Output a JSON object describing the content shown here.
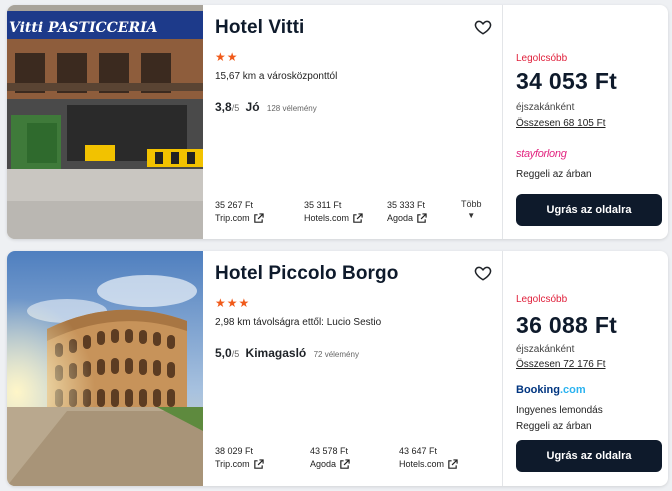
{
  "hotels": [
    {
      "name": "Hotel Vitti",
      "stars": "★★",
      "distance": "15,67 km a városközponttól",
      "score": "3,8",
      "of": "/5",
      "rating_word": "Jó",
      "reviews": "128 vélemény",
      "photo_sign": "Vitti PASTICCERIA",
      "offers": [
        {
          "price": "35 267 Ft",
          "site": "Trip.com"
        },
        {
          "price": "35 311 Ft",
          "site": "Hotels.com"
        },
        {
          "price": "35 333 Ft",
          "site": "Agoda"
        }
      ],
      "more_label": "Több",
      "cheapest_label": "Legolcsóbb",
      "best_price": "34 053 Ft",
      "per_night": "éjszakánként",
      "total": "Összesen 68 105 Ft",
      "provider": "stayforlong",
      "perks": [
        "Reggeli az árban"
      ],
      "cta": "Ugrás az oldalra"
    },
    {
      "name": "Hotel Piccolo Borgo",
      "stars": "★★★",
      "distance": "2,98 km távolságra ettől: Lucio Sestio",
      "score": "5,0",
      "of": "/5",
      "rating_word": "Kimagasló",
      "reviews": "72 vélemény",
      "offers": [
        {
          "price": "38 029 Ft",
          "site": "Trip.com"
        },
        {
          "price": "43 578 Ft",
          "site": "Agoda"
        },
        {
          "price": "43 647 Ft",
          "site": "Hotels.com"
        }
      ],
      "cheapest_label": "Legolcsóbb",
      "best_price": "36 088 Ft",
      "per_night": "éjszakánként",
      "total": "Összesen 72 176 Ft",
      "provider_main": "Booking",
      "provider_suffix": ".com",
      "perks": [
        "Ingyenes lemondás",
        "Reggeli az árban"
      ],
      "cta": "Ugrás az oldalra"
    }
  ],
  "colors": {
    "accent": "#f05a1a",
    "cheapest": "#e0203b",
    "button": "#0e1a2b",
    "stayforlong": "#e2237f",
    "booking": "#003580",
    "booking_dot": "#2bb3f0"
  }
}
